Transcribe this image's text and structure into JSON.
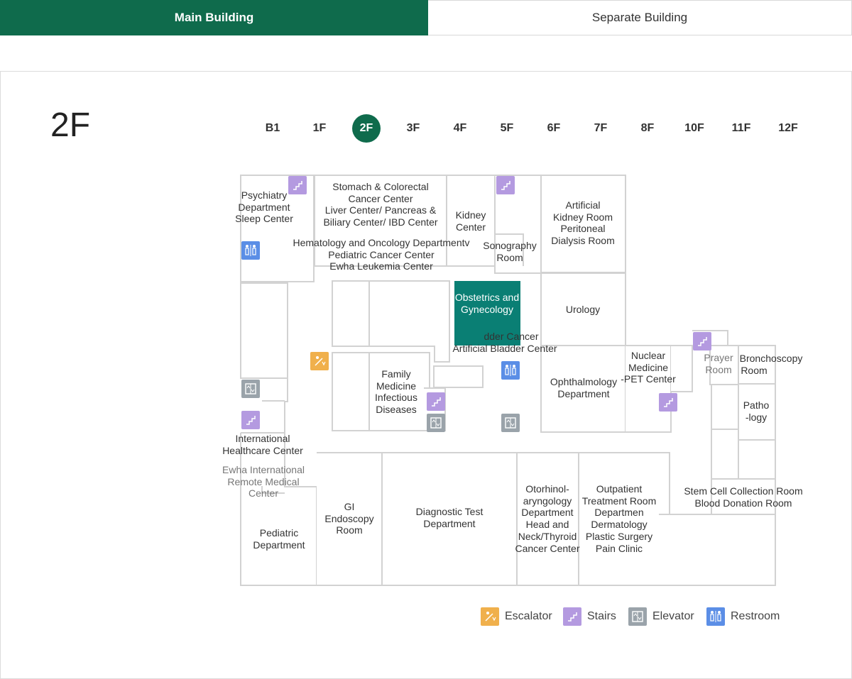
{
  "tabs": {
    "main": "Main Building",
    "separate": "Separate Building"
  },
  "floor_title": "2F",
  "floors": [
    "B1",
    "1F",
    "2F",
    "3F",
    "4F",
    "5F",
    "6F",
    "7F",
    "8F",
    "10F",
    "11F",
    "12F"
  ],
  "active_floor": "2F",
  "rooms": {
    "psychiatry": [
      "Psychiatry",
      "Department",
      "Sleep Center"
    ],
    "stomach": [
      "Stomach & Colorectal",
      "Cancer Center",
      "Liver Center/ Pancreas &",
      "Biliary Center/ IBD Center"
    ],
    "kidney": [
      "Kidney",
      "Center"
    ],
    "sonography": [
      "Sonography",
      "Room"
    ],
    "artificial_kidney": [
      "Artificial",
      "Kidney Room",
      "Peritoneal",
      "Dialysis Room"
    ],
    "hematology": [
      "Hematology and Oncology Departmentv",
      "Pediatric Cancer Center",
      "Ewha Leukemia Center"
    ],
    "obgyn": [
      "Obstetrics and",
      "Gynecology"
    ],
    "bladder": [
      "dder Cancer",
      "Artificial Bladder Center"
    ],
    "urology": [
      "Urology"
    ],
    "family": [
      "Family",
      "Medicine",
      "Infectious",
      "Diseases"
    ],
    "ophthalmology": [
      "Ophthalmology",
      "Department"
    ],
    "nuclear": [
      "Nuclear",
      "Medicine",
      "-PET Center"
    ],
    "prayer": [
      "Prayer",
      "Room"
    ],
    "bronchoscopy": [
      "Bronchoscopy",
      "Room"
    ],
    "pathology": [
      "Patho",
      "-logy"
    ],
    "international": [
      "International",
      "Healthcare Center"
    ],
    "remote": [
      "Ewha International",
      "Remote Medical",
      "Center"
    ],
    "pediatric": [
      "Pediatric",
      "Department"
    ],
    "gi": [
      "GI",
      "Endoscopy",
      "Room"
    ],
    "diagnostic": [
      "Diagnostic Test",
      "Department"
    ],
    "ent": [
      "Otorhinol-",
      "aryngology",
      "Department",
      "Head and",
      "Neck/Thyroid",
      "Cancer Center"
    ],
    "outpatient": [
      "Outpatient",
      "Treatment Room",
      "Departmen",
      "Dermatology",
      "Plastic Surgery",
      "Pain Clinic"
    ],
    "stemcell": [
      "Stem Cell Collection Room",
      "Blood Donation Room"
    ]
  },
  "legend": [
    {
      "label": "Escalator",
      "icon": "escalator-icon",
      "color": "#f0b04c"
    },
    {
      "label": "Stairs",
      "icon": "stairs-icon",
      "color": "#b49ae0"
    },
    {
      "label": "Elevator",
      "icon": "elevator-icon",
      "color": "#9aa3aa"
    },
    {
      "label": "Restroom",
      "icon": "restroom-icon",
      "color": "#5b8ee6"
    }
  ],
  "colors": {
    "brand": "#0f6b4c",
    "highlight": "#0a7f74"
  }
}
